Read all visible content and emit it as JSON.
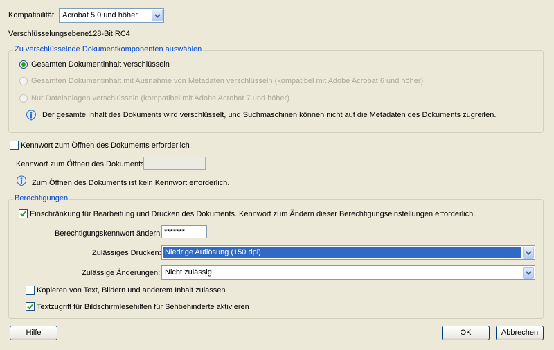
{
  "compatibility": {
    "label": "Kompatibilität:",
    "value": "Acrobat 5.0 und höher"
  },
  "encryption_level": {
    "label": "Verschlüsselungsebene:",
    "value": "128-Bit RC4"
  },
  "components_group": {
    "legend": "Zu verschlüsselnde Dokumentkomponenten auswählen",
    "options": [
      {
        "label": "Gesamten Dokumentinhalt verschlüsseln",
        "checked": true,
        "enabled": true
      },
      {
        "label": "Gesamten Dokumentinhalt mit Ausnahme von Metadaten verschlüsseln (kompatibel mit Adobe Acrobat 6 und höher)",
        "checked": false,
        "enabled": false
      },
      {
        "label": "Nur Dateianlagen verschlüsseln (kompatibel mit Adobe Acrobat 7 und höher)",
        "checked": false,
        "enabled": false
      }
    ],
    "info": "Der gesamte Inhalt des Dokuments wird verschlüsselt, und Suchmaschinen können nicht auf die Metadaten des Dokuments zugreifen."
  },
  "open_password": {
    "checkbox_label": "Kennwort zum Öffnen des Dokuments erforderlich",
    "checked": false,
    "field_label": "Kennwort zum Öffnen des Dokuments:",
    "field_value": "",
    "info": "Zum Öffnen des Dokuments ist kein Kennwort erforderlich."
  },
  "permissions_group": {
    "legend": "Berechtigungen",
    "restrict_label": "Einschränkung für Bearbeitung und Drucken des Dokuments. Kennwort zum Ändern dieser Berechtigungseinstellungen erforderlich.",
    "restrict_checked": true,
    "password_label": "Berechtigungskennwort ändern:",
    "password_value": "*******",
    "printing_label": "Zulässiges Drucken:",
    "printing_value": "Niedrige Auflösung (150 dpi)",
    "changes_label": "Zulässige Änderungen:",
    "changes_value": "Nicht zulässig",
    "copy_label": "Kopieren von Text, Bildern und anderem Inhalt zulassen",
    "copy_checked": false,
    "access_label": "Textzugriff für Bildschirmlesehilfen für Sehbehinderte aktivieren",
    "access_checked": true
  },
  "buttons": {
    "help": "Hilfe",
    "ok": "OK",
    "cancel": "Abbrechen"
  },
  "colors": {
    "legend": "#0046d5",
    "selection": "#316ac5",
    "checkmark": "#21a121",
    "info_icon": "#2a6fc9"
  },
  "icons": [
    "chevron-down-icon",
    "info-icon",
    "checkmark-icon"
  ]
}
